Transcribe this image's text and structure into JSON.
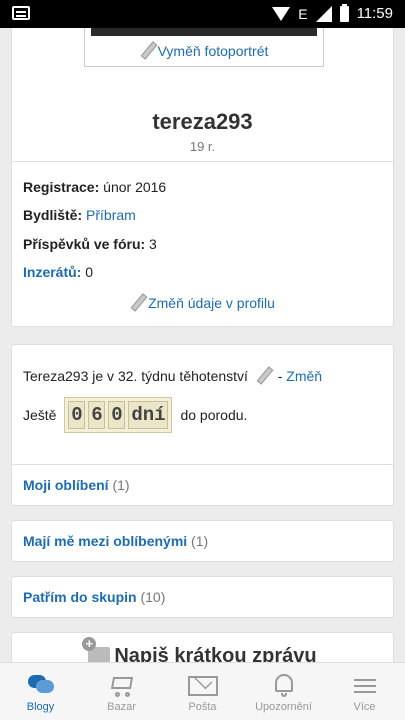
{
  "status_bar": {
    "network": "E",
    "time": "11:59"
  },
  "profile": {
    "photo_link": "Vyměň fotoportrét",
    "username": "tereza293",
    "age": "19 r."
  },
  "info": {
    "registration_label": "Registrace:",
    "registration_value": "únor 2016",
    "residence_label": "Bydliště:",
    "residence_value": "Příbram",
    "forum_posts_label": "Příspěvků ve fóru:",
    "forum_posts_value": "3",
    "ads_label": "Inzerátů:",
    "ads_value": "0",
    "edit_profile_link": "Změň údaje v profilu"
  },
  "pregnancy": {
    "text": "Tereza293 je v 32. týdnu těhotenství",
    "separator": "-",
    "change_link": "Změň",
    "prefix": "Ještě",
    "digits": [
      "0",
      "6",
      "0"
    ],
    "unit": "dní",
    "suffix": "do porodu."
  },
  "lists": [
    {
      "label": "Moji oblíbení",
      "count": "(1)"
    },
    {
      "label": "Mají mě mezi oblíbenými",
      "count": "(1)"
    },
    {
      "label": "Patřím do skupin",
      "count": "(10)"
    }
  ],
  "message": {
    "label": "Napiš krátkou zprávu"
  },
  "bottom_nav": [
    {
      "label": "Blogy",
      "active": true
    },
    {
      "label": "Bazar",
      "active": false
    },
    {
      "label": "Pošta",
      "active": false
    },
    {
      "label": "Upozornění",
      "active": false
    },
    {
      "label": "Více",
      "active": false
    }
  ],
  "colors": {
    "accent": "#1f6bb0",
    "background": "#ececec",
    "status_bar": "#000000"
  }
}
